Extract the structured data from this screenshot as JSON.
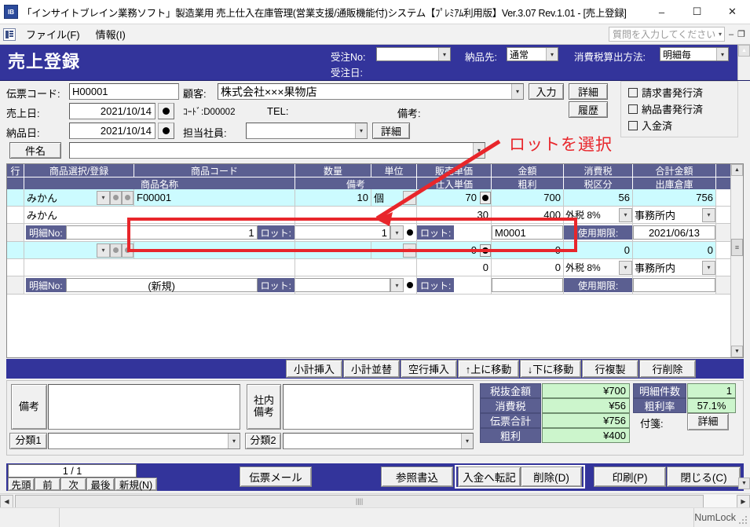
{
  "window": {
    "title": "「インサイトブレイン業務ソフト」製造業用 売上仕入在庫管理(営業支援/通販機能付)システム【ﾌﾟﾚﾐｱﾑ利用版】Ver.3.07 Rev.1.01 - [売上登録]",
    "minimize": "–",
    "maximize": "☐",
    "close": "✕"
  },
  "menubar": {
    "items": [
      "ファイル(F)",
      "情報(I)"
    ],
    "ask_placeholder": "質問を入力してください",
    "caret": "▾",
    "minimize": "–",
    "restore": "❐"
  },
  "header": {
    "form_title": "売上登録",
    "order_no_label": "受注No:",
    "order_no_value": "",
    "order_date_label": "受注日:",
    "order_date_value": "",
    "delivery_label": "納品先:",
    "delivery_value": "通常",
    "tax_method_label": "消費税算出方法:",
    "tax_method_value": "明細毎",
    "scroll_up": "▲"
  },
  "info": {
    "slip_code_label": "伝票コード:",
    "slip_code_value": "H00001",
    "sales_date_label": "売上日:",
    "sales_date_value": "2021/10/14",
    "delivery_date_label": "納品日:",
    "delivery_date_value": "2021/10/14",
    "subject_label": "件名",
    "subject_value": "",
    "customer_label": "顧客:",
    "customer_value": "株式会社×××果物店",
    "customer_code_label": "ｺｰﾄﾞ:D00002",
    "tel_label": "TEL:",
    "remarks_label": "備考:",
    "staff_label": "担当社員:",
    "staff_value": "",
    "input_button": "入力",
    "detail_button": "詳細",
    "history_button": "履歴",
    "staff_detail_button": "詳細",
    "checks": [
      {
        "label": "請求書発行済",
        "checked": false
      },
      {
        "label": "納品書発行済",
        "checked": false
      },
      {
        "label": "入金済",
        "checked": false
      }
    ]
  },
  "annotation": {
    "text": "ロットを選択"
  },
  "grid": {
    "header_row1": [
      "行",
      "商品選択/登録",
      "商品コード",
      "数量",
      "単位",
      "販売単価",
      "金額",
      "消費税",
      "合計金額",
      ""
    ],
    "header_row2": [
      "",
      "商品名称",
      "",
      "備考",
      "",
      "仕入単価",
      "粗利",
      "税区分",
      "出庫倉庫",
      ""
    ],
    "rows": [
      {
        "type": "item-main",
        "selected": true,
        "row_no": "",
        "product": "みかん",
        "code": "F00001",
        "qty": "10",
        "unit": "個",
        "price": "70",
        "amount": "700",
        "tax": "56",
        "total": "756"
      },
      {
        "type": "item-sub",
        "selected": false,
        "product_name": "みかん",
        "remarks": "",
        "cost": "30",
        "gross": "400",
        "tax_class": "外税 8%",
        "warehouse": "事務所内"
      },
      {
        "type": "lot",
        "detail_no_label": "明細No:",
        "detail_no_value": "1",
        "lot_label_1": "ロット:",
        "lot_qty": "1",
        "lot_label_2": "ロット:",
        "lot_code": "M0001",
        "expiry_label": "使用期限:",
        "expiry_value": "2021/06/13"
      },
      {
        "type": "item-main",
        "selected": true,
        "row_no": "",
        "product": "",
        "code": "",
        "qty": "",
        "unit": "",
        "price": "0",
        "amount": "0",
        "tax": "0",
        "total": "0"
      },
      {
        "type": "item-sub",
        "selected": false,
        "product_name": "",
        "remarks": "",
        "cost": "0",
        "gross": "0",
        "tax_class": "外税 8%",
        "warehouse": "事務所内"
      },
      {
        "type": "lot",
        "detail_no_label": "明細No:",
        "detail_no_value": "(新規)",
        "lot_label_1": "ロット:",
        "lot_qty": "",
        "lot_label_2": "ロット:",
        "lot_code": "",
        "expiry_label": "使用期限:",
        "expiry_value": ""
      }
    ],
    "scroll_up": "▲",
    "scroll_down": "▼",
    "thumb_glyph": "≡"
  },
  "rowbar": {
    "buttons": [
      "小計挿入",
      "小計並替",
      "空行挿入",
      "↑上に移動",
      "↓下に移動",
      "行複製",
      "行削除"
    ]
  },
  "footer": {
    "remarks_label": "備考",
    "remarks_value": "",
    "internal_remarks_label": "社内\n備考",
    "internal_remarks_value": "",
    "class1_label": "分類1",
    "class1_value": "",
    "class2_label": "分類2",
    "class2_value": "",
    "totals": [
      {
        "label": "税抜金額",
        "value": "¥700"
      },
      {
        "label": "消費税",
        "value": "¥56"
      },
      {
        "label": "伝票合計",
        "value": "¥756"
      },
      {
        "label": "粗利",
        "value": "¥400"
      }
    ],
    "count_label": "明細件数",
    "count_value": "1",
    "margin_rate_label": "粗利率",
    "margin_rate_value": "57.1%",
    "tag_label": "付箋:",
    "tag_detail_button": "詳細"
  },
  "navbar": {
    "page_indicator": "1 / 1",
    "nav_buttons": [
      "先頭",
      "前",
      "次",
      "最後",
      "新規(N)"
    ],
    "mail_button": "伝票メール",
    "reference_button": "参照書込",
    "transfer_button": "入金へ転記",
    "delete_button": "削除(D)",
    "print_button": "印刷(P)",
    "close_button": "閉じる(C)",
    "scroll_down": "▼",
    "scroll_right": "▶"
  },
  "hscroll": {
    "left_arrow": "◀",
    "right_arrow": "▶",
    "thumb_glyph": "||||"
  },
  "statusbar": {
    "numlock": "NumLock"
  },
  "colors": {
    "header_blue": "#33349b",
    "grid_header": "#5b5f91",
    "selected_row": "#ccfbff",
    "total_green": "#ccf5cc",
    "annotation_red": "#e8262b"
  }
}
